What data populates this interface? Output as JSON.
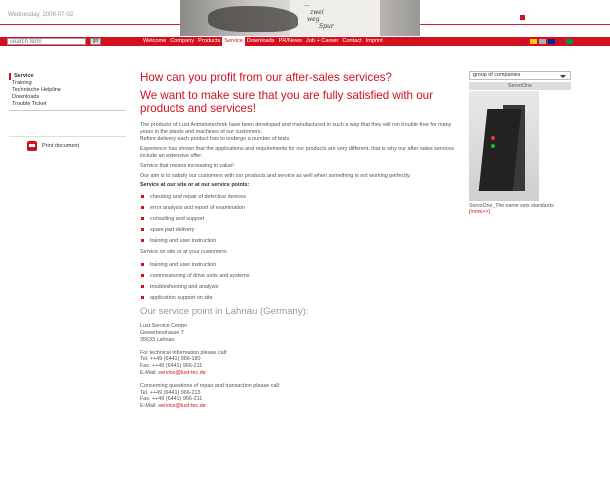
{
  "header": {
    "date": "Wednesday, 2008-07-02",
    "banner_text": [
      "...",
      "zwei",
      "weg",
      "Spur"
    ]
  },
  "search": {
    "placeholder": "search term",
    "button": "go"
  },
  "menu": [
    {
      "label": "Welcome",
      "active": false
    },
    {
      "label": "Company",
      "active": false
    },
    {
      "label": "Products",
      "active": false
    },
    {
      "label": "Service",
      "active": true
    },
    {
      "label": "Downloads",
      "active": false
    },
    {
      "label": "PR/News",
      "active": false
    },
    {
      "label": "Job + Career",
      "active": false
    },
    {
      "label": "Contact",
      "active": false
    },
    {
      "label": "Imprint",
      "active": false
    }
  ],
  "flags": [
    "#c8102e",
    "#ffce00",
    "#b0b0b0",
    "#002395",
    "#c8102e",
    "#009246"
  ],
  "sidebar": {
    "items": [
      {
        "label": "Service",
        "active": true
      },
      {
        "label": "Training",
        "active": false
      },
      {
        "label": "Technische Helpline",
        "active": false
      },
      {
        "label": "Downloads",
        "active": false
      },
      {
        "label": "Trouble Ticket",
        "active": false
      }
    ],
    "print_label": "Print document"
  },
  "main": {
    "h1": "How can you profit from our after-sales services?",
    "h2": "We want to make sure that you are fully satisfied with our products and services!",
    "p1": "The products of Lust Antriebstechnik have been developed and manufactured in such a way that they will run trouble-free for many years in the plants and machines of our customers.",
    "p1b": "Before delivery each product has to undergo a number of tests.",
    "p2": "Experience has shown that the applications and requirements for our products are very different, that is why our after-sales services include an extensive offer.",
    "p3": "Service that means increasing in value!",
    "p4": "Our aim is to satisfy our customers with our products and service as well when something is not working perfectly.",
    "bold1": "Service at our site or at our service points:",
    "list1": [
      "checking and repair of defective devices",
      "error analysis and report of examination",
      "consulting and support",
      "spare part delivery",
      "training and user instruction"
    ],
    "sub2": "Service on site or at your customers:",
    "list2": [
      "training and user instruction",
      "commissioning of drive units and systems",
      "troubleshooting and analysis",
      "application support on site"
    ],
    "h3": "Our service point in Lahnau (Germany):",
    "addr": [
      "Lust Service Center",
      "Gewerbestrasse 7",
      "35633 Lahnau"
    ],
    "tech_intro": "For technical information please call:",
    "tech_tel": "Tel. ++49 (6441) 966-180",
    "tech_fax": "Fax. ++49 (6441) 966-211",
    "tech_email_label": "E-Mail:",
    "tech_email": "service@lust-tec.de",
    "rep_intro": "Concerning questions of repair and transaction please call:",
    "rep_tel": "Tel. ++49 (6441) 966-213",
    "rep_fax": "Fax. ++49 (6441) 966-211",
    "rep_email_label": "E-Mail:",
    "rep_email": "service@lust-tec.de"
  },
  "right": {
    "group_select": "group of companies",
    "box_title": "ServoOne",
    "caption": "ServoOne_The name sets standards",
    "more": "[more>>]"
  },
  "colors": {
    "accent": "#d4101e"
  }
}
